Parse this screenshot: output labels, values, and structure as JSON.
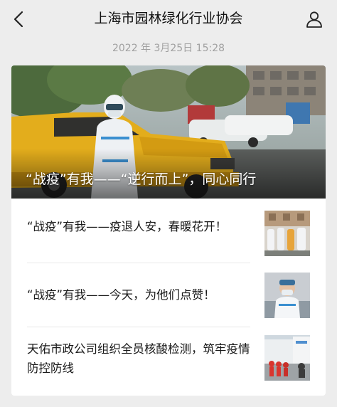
{
  "header": {
    "title": "上海市园林绿化行业协会",
    "back_icon": "chevron-left-icon",
    "profile_icon": "person-icon"
  },
  "message": {
    "timestamp": "2022 年 3月25日 15:28"
  },
  "feature": {
    "title": "“战疫”有我——“逆行而上”，同心同行"
  },
  "articles": [
    {
      "title": "“战疫”有我——疫退人安，春暖花开！"
    },
    {
      "title": "“战疫”有我——今天，为他们点赞！"
    },
    {
      "title": "天佑市政公司组织全员核酸检测，筑牢疫情防控防线"
    }
  ],
  "colors": {
    "background": "#ededed",
    "card": "#ffffff",
    "timestamp": "#a0a0a0",
    "text": "#1a1a1a"
  }
}
